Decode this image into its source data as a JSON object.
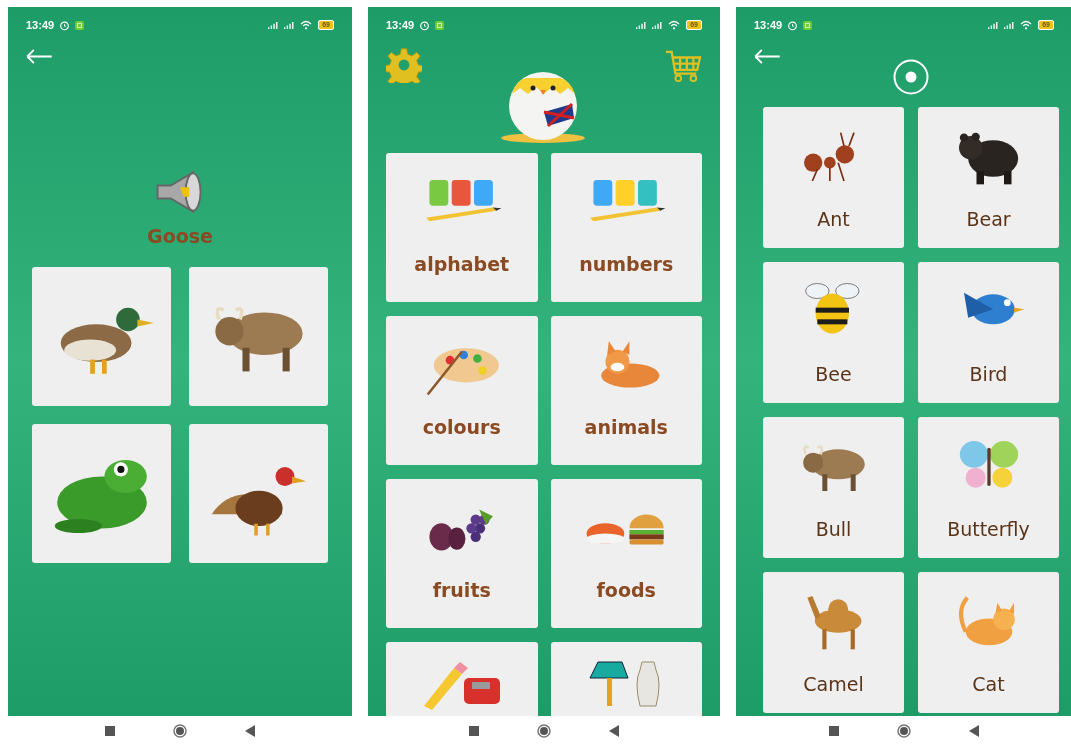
{
  "screens": [
    {
      "kind": "quiz",
      "status": {
        "time": "13:49",
        "battery": "69"
      },
      "word": "Goose"
    },
    {
      "kind": "menu",
      "status": {
        "time": "13:49",
        "battery": "69"
      },
      "categories": [
        {
          "label": "alphabet"
        },
        {
          "label": "numbers"
        },
        {
          "label": "colours"
        },
        {
          "label": "animals"
        },
        {
          "label": "fruits"
        },
        {
          "label": "foods"
        }
      ]
    },
    {
      "kind": "list",
      "status": {
        "time": "13:49",
        "battery": "69"
      },
      "animals": [
        {
          "label": "Ant"
        },
        {
          "label": "Bear"
        },
        {
          "label": "Bee"
        },
        {
          "label": "Bird"
        },
        {
          "label": "Bull"
        },
        {
          "label": "Butterfly"
        },
        {
          "label": "Camel"
        },
        {
          "label": "Cat"
        }
      ]
    }
  ]
}
